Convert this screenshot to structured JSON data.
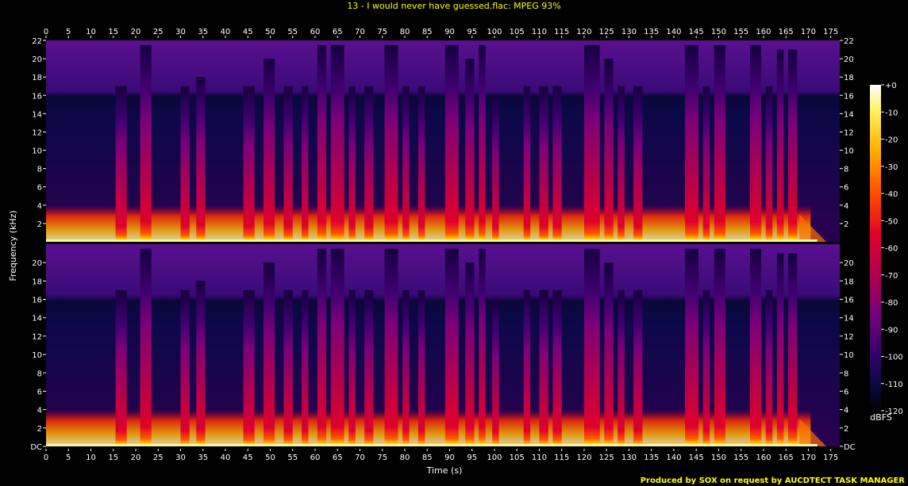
{
  "chart_data": {
    "type": "heatmap",
    "title": "13 - I would never have guessed.flac: MPEG 93%",
    "xlabel": "Time (s)",
    "ylabel": "Frequency (kHz)",
    "x_ticks": [
      "0",
      "5",
      "10",
      "15",
      "20",
      "25",
      "30",
      "35",
      "40",
      "45",
      "50",
      "55",
      "60",
      "65",
      "70",
      "75",
      "80",
      "85",
      "90",
      "95",
      "100",
      "105",
      "110",
      "115",
      "120",
      "125",
      "130",
      "135",
      "140",
      "145",
      "150",
      "155",
      "160",
      "165",
      "170",
      "175"
    ],
    "x_tick_values": [
      0,
      5,
      10,
      15,
      20,
      25,
      30,
      35,
      40,
      45,
      50,
      55,
      60,
      65,
      70,
      75,
      80,
      85,
      90,
      95,
      100,
      105,
      110,
      115,
      120,
      125,
      130,
      135,
      140,
      145,
      150,
      155,
      160,
      165,
      170,
      175
    ],
    "xlim": [
      0,
      177
    ],
    "channels": [
      {
        "name": "channel-1",
        "y_ticks": [
          "2",
          "4",
          "6",
          "8",
          "10",
          "12",
          "14",
          "16",
          "18",
          "20",
          "22"
        ],
        "y_tick_values": [
          2,
          4,
          6,
          8,
          10,
          12,
          14,
          16,
          18,
          20,
          22
        ],
        "ylim": [
          0,
          22
        ]
      },
      {
        "name": "channel-2",
        "y_ticks": [
          "DC",
          "2",
          "4",
          "6",
          "8",
          "10",
          "12",
          "14",
          "16",
          "18",
          "20"
        ],
        "y_tick_values": [
          0,
          2,
          4,
          6,
          8,
          10,
          12,
          14,
          16,
          18,
          20
        ],
        "ylim": [
          0,
          22
        ]
      }
    ],
    "colorbar": {
      "label": "dBFS",
      "ticks": [
        "+0",
        "-10",
        "-20",
        "-30",
        "-40",
        "-50",
        "-60",
        "-70",
        "-80",
        "-90",
        "-100",
        "-110",
        "-120"
      ],
      "tick_values": [
        0,
        -10,
        -20,
        -30,
        -40,
        -50,
        -60,
        -70,
        -80,
        -90,
        -100,
        -110,
        -120
      ],
      "range": [
        -120,
        0
      ]
    },
    "lowpass_khz": 16,
    "bursts": [
      {
        "start": 15.5,
        "end": 18.0,
        "top": 17
      },
      {
        "start": 21.0,
        "end": 23.5,
        "top": 21.5
      },
      {
        "start": 30.0,
        "end": 32.0,
        "top": 17
      },
      {
        "start": 33.5,
        "end": 35.5,
        "top": 18
      },
      {
        "start": 44.0,
        "end": 46.5,
        "top": 17
      },
      {
        "start": 48.5,
        "end": 51.0,
        "top": 20
      },
      {
        "start": 53.0,
        "end": 55.0,
        "top": 17
      },
      {
        "start": 57.0,
        "end": 58.5,
        "top": 17
      },
      {
        "start": 60.5,
        "end": 62.5,
        "top": 21.5
      },
      {
        "start": 63.5,
        "end": 66.5,
        "top": 21.5
      },
      {
        "start": 67.5,
        "end": 69.0,
        "top": 17
      },
      {
        "start": 71.0,
        "end": 73.0,
        "top": 17
      },
      {
        "start": 75.5,
        "end": 78.5,
        "top": 21.5
      },
      {
        "start": 79.5,
        "end": 81.0,
        "top": 17
      },
      {
        "start": 83.0,
        "end": 84.5,
        "top": 17
      },
      {
        "start": 89.0,
        "end": 92.0,
        "top": 21.5
      },
      {
        "start": 93.5,
        "end": 95.5,
        "top": 20
      },
      {
        "start": 96.5,
        "end": 98.0,
        "top": 21.5
      },
      {
        "start": 99.5,
        "end": 101.0,
        "top": 16
      },
      {
        "start": 106.5,
        "end": 108.0,
        "top": 17
      },
      {
        "start": 110.0,
        "end": 112.0,
        "top": 17
      },
      {
        "start": 113.0,
        "end": 115.0,
        "top": 17
      },
      {
        "start": 120.0,
        "end": 123.5,
        "top": 21.5
      },
      {
        "start": 124.5,
        "end": 126.5,
        "top": 20
      },
      {
        "start": 127.5,
        "end": 129.0,
        "top": 17
      },
      {
        "start": 131.0,
        "end": 133.0,
        "top": 17
      },
      {
        "start": 142.5,
        "end": 145.5,
        "top": 21.5
      },
      {
        "start": 146.5,
        "end": 148.0,
        "top": 17
      },
      {
        "start": 149.0,
        "end": 151.5,
        "top": 21.5
      },
      {
        "start": 157.0,
        "end": 159.5,
        "top": 21.5
      },
      {
        "start": 160.5,
        "end": 162.0,
        "top": 17
      },
      {
        "start": 163.0,
        "end": 164.5,
        "top": 21
      },
      {
        "start": 165.5,
        "end": 167.5,
        "top": 21
      }
    ],
    "grid": false,
    "legend": "colorbar-right"
  },
  "footer": {
    "credit": "Produced by SOX on request by AUCDTECT TASK MANAGER"
  },
  "colors": {
    "background": "#000000",
    "title": "#ffff00",
    "text": "#ffffff",
    "credit": "#ffff00"
  }
}
